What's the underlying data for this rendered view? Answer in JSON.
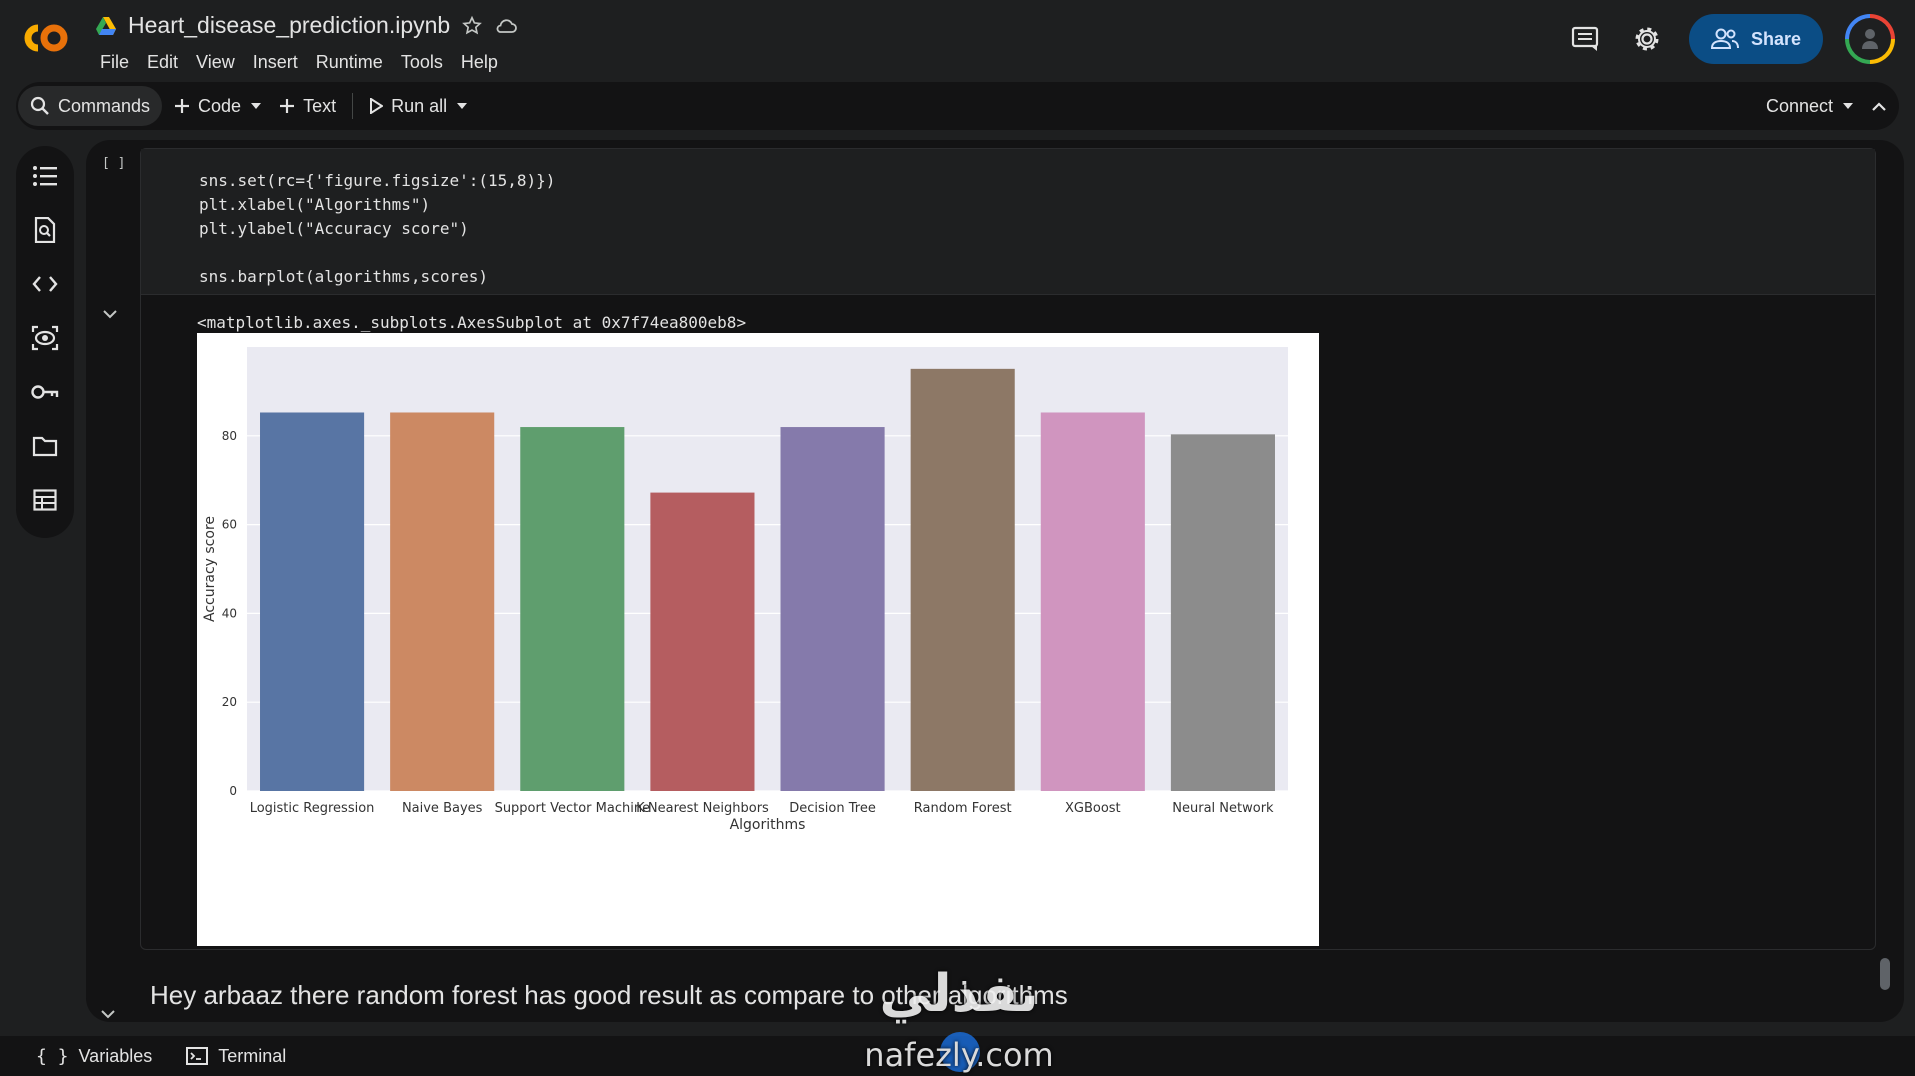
{
  "header": {
    "logo_text": "CO",
    "title": "Heart_disease_prediction.ipynb",
    "menus": [
      "File",
      "Edit",
      "View",
      "Insert",
      "Runtime",
      "Tools",
      "Help"
    ],
    "share_label": "Share"
  },
  "toolbar": {
    "commands_label": "Commands",
    "code_label": "Code",
    "text_label": "Text",
    "run_all_label": "Run all",
    "connect_label": "Connect"
  },
  "sidebar": {
    "icons": [
      "table-of-contents-icon",
      "find-icon",
      "code-snippets-icon",
      "variables-inspector-icon",
      "secrets-key-icon",
      "files-folder-icon",
      "data-table-icon"
    ]
  },
  "cell": {
    "bracket": "[ ]",
    "code_lines": [
      "sns.set(rc={'figure.figsize':(15,8)})",
      "plt.xlabel(\"Algorithms\")",
      "plt.ylabel(\"Accuracy score\")",
      "",
      "sns.barplot(algorithms,scores)"
    ],
    "output_repr": "<matplotlib.axes._subplots.AxesSubplot at 0x7f74ea800eb8>"
  },
  "chart_data": {
    "type": "bar",
    "categories": [
      "Logistic Regression",
      "Naive Bayes",
      "Support Vector Machine",
      "K-Nearest Neighbors",
      "Decision Tree",
      "Random Forest",
      "XGBoost",
      "Neural Network"
    ],
    "values": [
      85.25,
      85.25,
      81.97,
      67.21,
      81.97,
      95.08,
      85.25,
      80.33
    ],
    "colors": [
      "#5875a4",
      "#cc8963",
      "#5f9e6e",
      "#b55d60",
      "#857aab",
      "#8d7866",
      "#d095bf",
      "#8c8c8c"
    ],
    "xlabel": "Algorithms",
    "ylabel": "Accuracy score",
    "yticks": [
      0,
      20,
      40,
      60,
      80
    ],
    "ylim": [
      0,
      100
    ],
    "grid": true,
    "background": "#eaeaf2"
  },
  "markdown": {
    "text": "Hey arbaaz there random forest has good result as compare to other algorithms"
  },
  "bottombar": {
    "variables_label": "Variables",
    "terminal_label": "Terminal"
  },
  "watermark": {
    "arabic": "نفذلي",
    "url": "nafezly.com"
  }
}
